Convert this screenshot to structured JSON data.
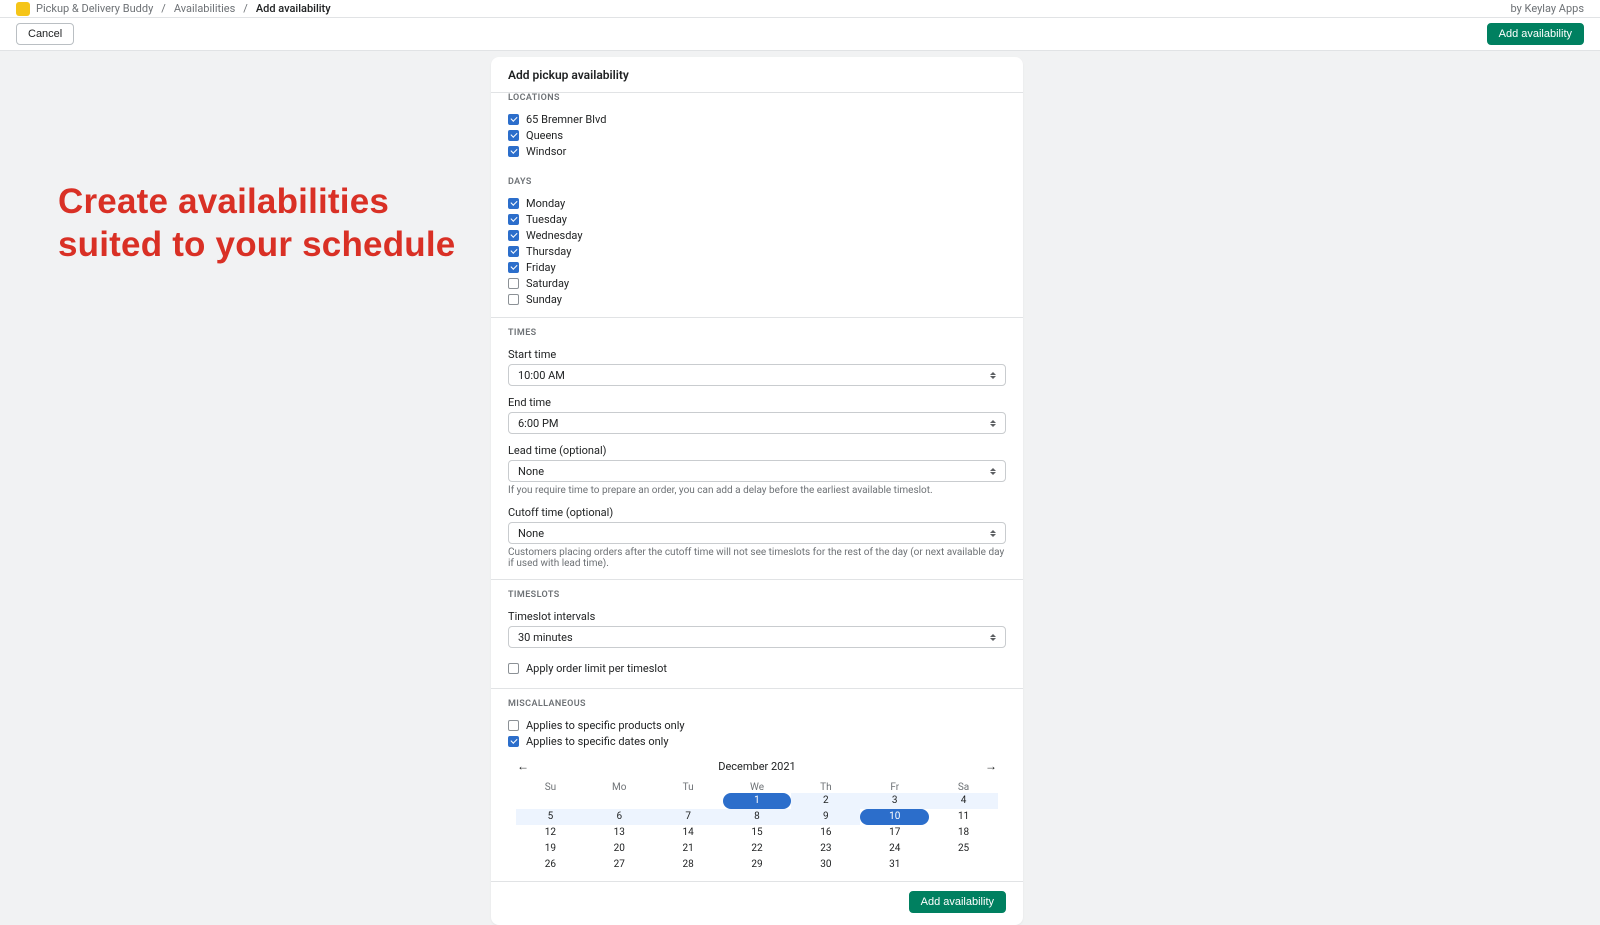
{
  "breadcrumb": {
    "app": "Pickup & Delivery Buddy",
    "mid": "Availabilities",
    "current": "Add availability",
    "attribution": "by Keylay Apps"
  },
  "actionbar": {
    "cancel": "Cancel",
    "primary": "Add availability"
  },
  "hero": {
    "line1": "Create availabilities",
    "line2": "suited to your schedule"
  },
  "card_title": "Add pickup availability",
  "sections": {
    "locations": {
      "heading": "LOCATIONS",
      "items": [
        {
          "label": "65 Bremner Blvd",
          "checked": true
        },
        {
          "label": "Queens",
          "checked": true
        },
        {
          "label": "Windsor",
          "checked": true
        }
      ]
    },
    "days": {
      "heading": "DAYS",
      "items": [
        {
          "label": "Monday",
          "checked": true
        },
        {
          "label": "Tuesday",
          "checked": true
        },
        {
          "label": "Wednesday",
          "checked": true
        },
        {
          "label": "Thursday",
          "checked": true
        },
        {
          "label": "Friday",
          "checked": true
        },
        {
          "label": "Saturday",
          "checked": false
        },
        {
          "label": "Sunday",
          "checked": false
        }
      ]
    },
    "times": {
      "heading": "TIMES",
      "start_label": "Start time",
      "start_value": "10:00 AM",
      "end_label": "End time",
      "end_value": "6:00 PM",
      "lead_label": "Lead time (optional)",
      "lead_value": "None",
      "lead_help": "If you require time to prepare an order, you can add a delay before the earliest available timeslot.",
      "cutoff_label": "Cutoff time (optional)",
      "cutoff_value": "None",
      "cutoff_help": "Customers placing orders after the cutoff time will not see timeslots for the rest of the day (or next available day if used with lead time)."
    },
    "timeslots": {
      "heading": "TIMESLOTS",
      "interval_label": "Timeslot intervals",
      "interval_value": "30 minutes",
      "limit_label": "Apply order limit per timeslot",
      "limit_checked": false
    },
    "misc": {
      "heading": "MISCALLANEOUS",
      "products_label": "Applies to specific products only",
      "products_checked": false,
      "dates_label": "Applies to specific dates only",
      "dates_checked": true
    },
    "calendar": {
      "month": "December 2021",
      "dow": [
        "Su",
        "Mo",
        "Tu",
        "We",
        "Th",
        "Fr",
        "Sa"
      ],
      "selected_dates": [
        1,
        10
      ],
      "rows": [
        [
          "",
          "",
          "",
          "1",
          "2",
          "3",
          "4"
        ],
        [
          "5",
          "6",
          "7",
          "8",
          "9",
          "10",
          "11"
        ],
        [
          "12",
          "13",
          "14",
          "15",
          "16",
          "17",
          "18"
        ],
        [
          "19",
          "20",
          "21",
          "22",
          "23",
          "24",
          "25"
        ],
        [
          "26",
          "27",
          "28",
          "29",
          "30",
          "31",
          ""
        ]
      ]
    }
  },
  "footer_add": "Add availability"
}
